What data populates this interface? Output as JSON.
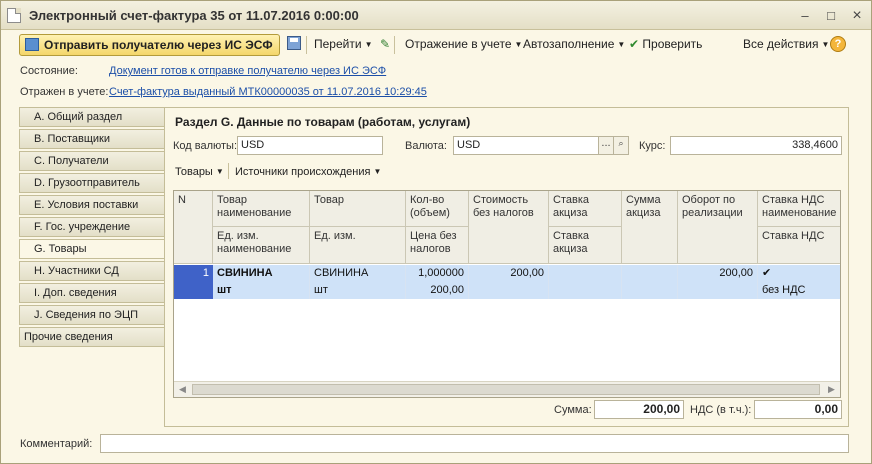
{
  "window": {
    "title": "Электронный счет-фактура 35 от 11.07.2016 0:00:00",
    "minimize": "–",
    "maximize": "□",
    "close": "×"
  },
  "toolbar": {
    "send_label": "Отправить получателю через ИС ЭСФ",
    "goto_label": "Перейти",
    "accounting_label": "Отражение в учете",
    "autofill_label": "Автозаполнение",
    "check_label": "Проверить",
    "all_actions_label": "Все действия",
    "help": "?",
    "caret": "▼",
    "check_mark": "✔",
    "pencil": "✎"
  },
  "info": {
    "state_label": "Состояние:",
    "state_value": "Документ готов к отправке получателю через ИС ЭСФ",
    "reflected_label": "Отражен в учете:",
    "reflected_value": "Счет-фактура выданный МТК00000035 от 11.07.2016 10:29:45"
  },
  "tabs": [
    {
      "label": "A. Общий раздел"
    },
    {
      "label": "B. Поставщики"
    },
    {
      "label": "C. Получатели"
    },
    {
      "label": "D. Грузоотправитель"
    },
    {
      "label": "E. Условия поставки"
    },
    {
      "label": "F. Гос. учреждение"
    },
    {
      "label": "G. Товары"
    },
    {
      "label": "H. Участники СД"
    },
    {
      "label": "I. Доп. сведения"
    },
    {
      "label": "J. Сведения по ЭЦП"
    },
    {
      "label": "Прочие сведения"
    }
  ],
  "section": {
    "title": "Раздел G. Данные по товарам (работам, услугам)",
    "currency_code_label": "Код валюты:",
    "currency_code_value": "USD",
    "currency_label": "Валюта:",
    "currency_value": "USD",
    "rate_label": "Курс:",
    "rate_value": "338,4600",
    "dots": "...",
    "search_glyph": "🔍",
    "goods_menu": "Товары",
    "origins_menu": "Источники происхождения"
  },
  "table": {
    "headers_top": [
      "N",
      "Товар наименование",
      "Товар",
      "Кол-во (объем)",
      "Стоимость без налогов",
      "Ставка акциза",
      "Сумма акциза",
      "Оборот по реализации",
      "Ставка НДС наименование"
    ],
    "headers_bottom": [
      "Ед. изм. наименование",
      "Ед. изм.",
      "Цена без налогов",
      "Ставка акциза",
      "Ставка НДС"
    ],
    "row1": {
      "n": "1",
      "name": "СВИНИНА",
      "product": "СВИНИНА",
      "qty": "1,000000",
      "cost": "200,00",
      "turnover": "200,00",
      "vat_check": "✔"
    },
    "row2": {
      "unit_name": "шт",
      "unit": "шт",
      "price": "200,00",
      "vat_rate": "без НДС"
    },
    "scroll_left": "◀",
    "scroll_right": "▶"
  },
  "totals": {
    "sum_label": "Сумма:",
    "sum_value": "200,00",
    "vat_label": "НДС (в т.ч.):",
    "vat_value": "0,00"
  },
  "comment": {
    "label": "Комментарий:",
    "value": ""
  }
}
